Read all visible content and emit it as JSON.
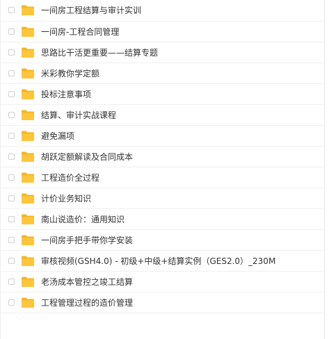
{
  "files": [
    {
      "name": "一间房工程结算与审计实训",
      "icon": "folder-icon"
    },
    {
      "name": "一间房-工程合同管理",
      "icon": "folder-icon"
    },
    {
      "name": "思路比干活更重要——结算专题",
      "icon": "folder-icon"
    },
    {
      "name": "米彩教你学定额",
      "icon": "folder-icon"
    },
    {
      "name": "投标注意事项",
      "icon": "folder-icon"
    },
    {
      "name": "结算、审计实战课程",
      "icon": "folder-icon"
    },
    {
      "name": "避免漏项",
      "icon": "folder-icon"
    },
    {
      "name": "胡跃定额解读及合同成本",
      "icon": "folder-icon"
    },
    {
      "name": "工程造价全过程",
      "icon": "folder-icon"
    },
    {
      "name": "计价业务知识",
      "icon": "folder-icon"
    },
    {
      "name": "南山说造价：通用知识",
      "icon": "folder-icon"
    },
    {
      "name": "一间房手把手带你学安装",
      "icon": "folder-icon"
    },
    {
      "name": "审核视频(GSH4.0) - 初级+中级+结算实例（GES2.0）_230M",
      "icon": "folder-icon"
    },
    {
      "name": "老汤成本管控之竣工结算",
      "icon": "folder-icon"
    },
    {
      "name": "工程管理过程的造价管理",
      "icon": "folder-icon"
    }
  ],
  "colors": {
    "folder": "#ffc53d",
    "folder_tab": "#f5b623",
    "text": "#333333",
    "row_border": "#f0f0f0",
    "checkbox_border": "#d0d0d0"
  }
}
